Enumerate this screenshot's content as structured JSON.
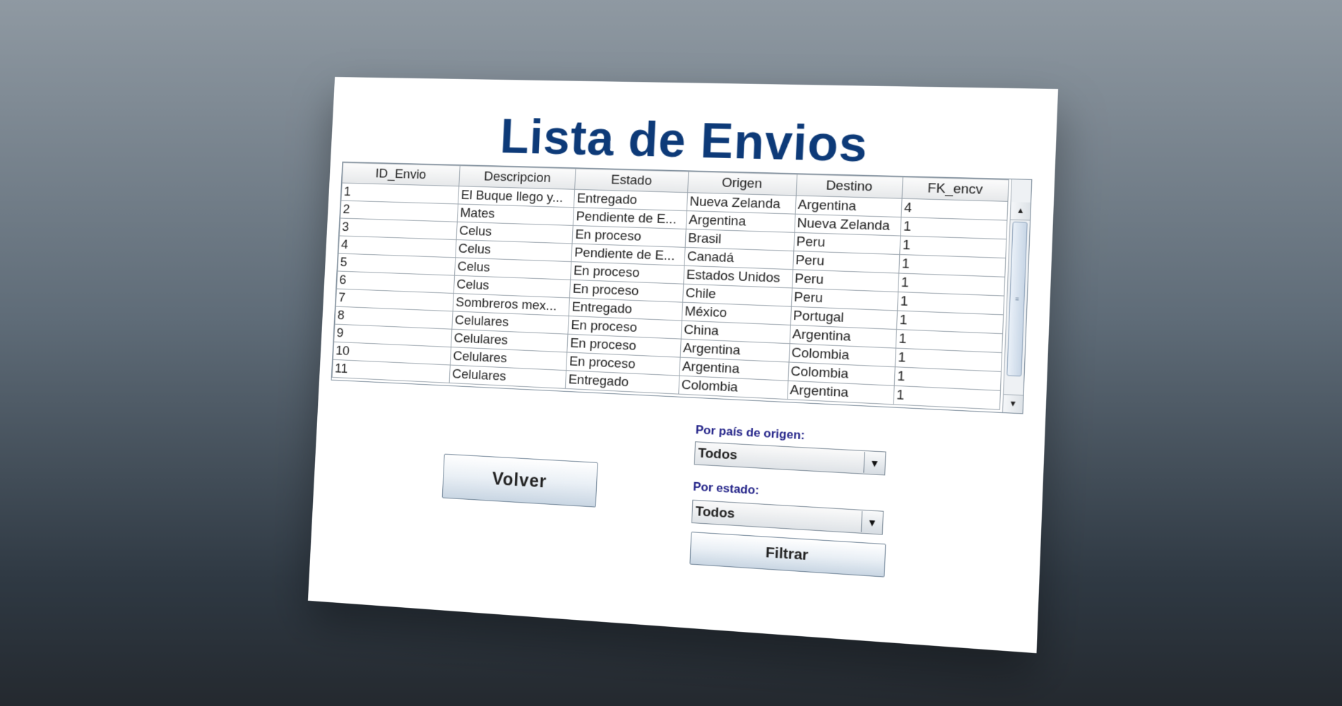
{
  "window": {
    "title": "Lista de Envios"
  },
  "table": {
    "columns": [
      "ID_Envio",
      "Descripcion",
      "Estado",
      "Origen",
      "Destino",
      "FK_encv"
    ],
    "rows": [
      [
        "1",
        "El Buque llego y...",
        "Entregado",
        "Nueva Zelanda",
        "Argentina",
        "4"
      ],
      [
        "2",
        "Mates",
        "Pendiente de E...",
        "Argentina",
        "Nueva Zelanda",
        "1"
      ],
      [
        "3",
        "Celus",
        "En proceso",
        "Brasil",
        "Peru",
        "1"
      ],
      [
        "4",
        "Celus",
        "Pendiente de E...",
        "Canadá",
        "Peru",
        "1"
      ],
      [
        "5",
        "Celus",
        "En proceso",
        "Estados Unidos",
        "Peru",
        "1"
      ],
      [
        "6",
        "Celus",
        "En proceso",
        "Chile",
        "Peru",
        "1"
      ],
      [
        "7",
        "Sombreros mex...",
        "Entregado",
        "México",
        "Portugal",
        "1"
      ],
      [
        "8",
        "Celulares",
        "En proceso",
        "China",
        "Argentina",
        "1"
      ],
      [
        "9",
        "Celulares",
        "En proceso",
        "Argentina",
        "Colombia",
        "1"
      ],
      [
        "10",
        "Celulares",
        "En proceso",
        "Argentina",
        "Colombia",
        "1"
      ],
      [
        "11",
        "Celulares",
        "Entregado",
        "Colombia",
        "Argentina",
        "1"
      ]
    ]
  },
  "buttons": {
    "volver": "Volver",
    "filtrar": "Filtrar"
  },
  "filters": {
    "origen_label": "Por país de origen:",
    "origen_value": "Todos",
    "estado_label": "Por estado:",
    "estado_value": "Todos"
  },
  "icons": {
    "scroll_up": "triangle-up-icon",
    "scroll_down": "triangle-down-icon",
    "combo_arrow": "chevron-down-icon"
  },
  "colors": {
    "title": "#0d3a78",
    "label": "#222288"
  }
}
